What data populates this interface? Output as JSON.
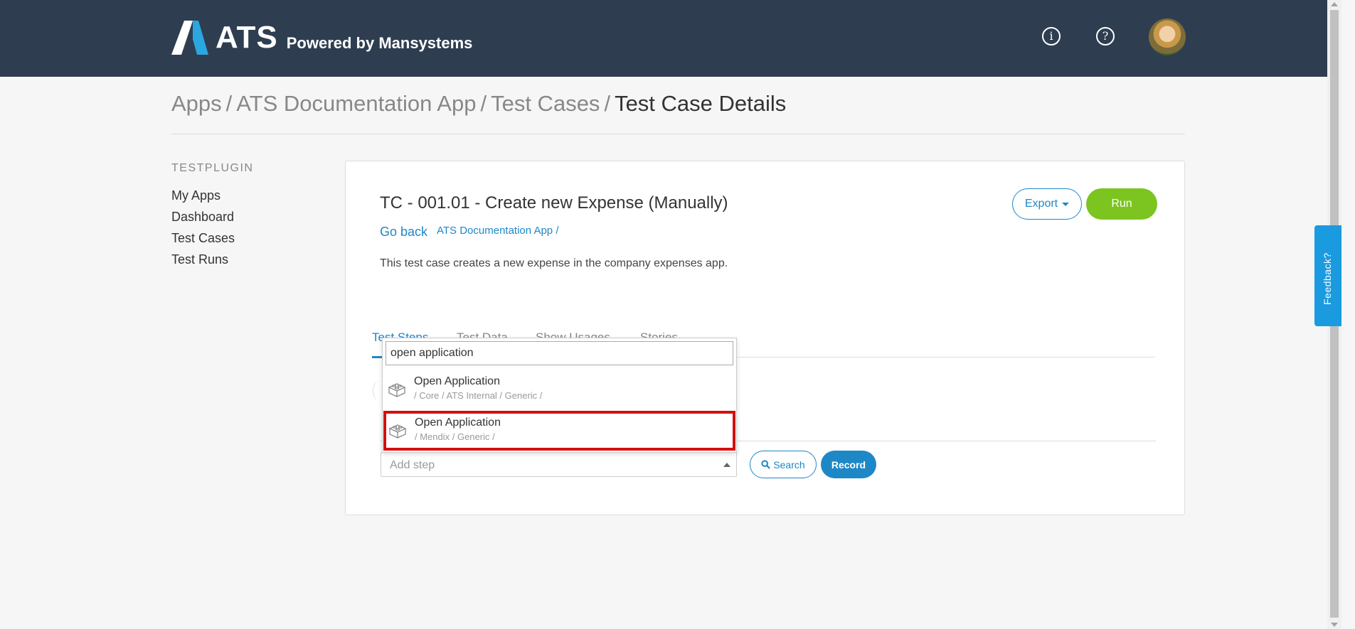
{
  "header": {
    "logo_text": "ATS",
    "logo_sub": "Powered by Mansystems",
    "info_icon": "info-icon",
    "help_icon": "help-icon"
  },
  "breadcrumb": {
    "items": [
      "Apps",
      "ATS Documentation App",
      "Test Cases",
      "Test Case Details"
    ],
    "separator": "/"
  },
  "sidebar": {
    "heading": "TESTPLUGIN",
    "items": [
      {
        "label": "My Apps"
      },
      {
        "label": "Dashboard"
      },
      {
        "label": "Test Cases"
      },
      {
        "label": "Test Runs"
      }
    ]
  },
  "testcase": {
    "title": "TC - 001.01 - Create new Expense (Manually)",
    "go_back": "Go back",
    "app_link": "ATS Documentation App /",
    "description": "This test case creates a new expense in the company expenses app.",
    "export_label": "Export",
    "run_label": "Run"
  },
  "tabs": [
    {
      "label": "Test Steps",
      "active": true
    },
    {
      "label": "Test Data"
    },
    {
      "label": "Show Usages"
    },
    {
      "label": "Stories"
    }
  ],
  "add_step": {
    "placeholder": "Add step",
    "search_label": "Search",
    "record_label": "Record"
  },
  "dropdown": {
    "query": "open application",
    "options": [
      {
        "title": "Open Application",
        "path": "/ Core / ATS Internal / Generic /",
        "highlighted": false
      },
      {
        "title": "Open Application",
        "path": "/ Mendix / Generic /",
        "highlighted": true
      }
    ]
  },
  "feedback_label": "Feedback?",
  "colors": {
    "header_bg": "#2e3e50",
    "accent": "#1e88c7",
    "run": "#7cc520",
    "highlight": "#d40f0f",
    "feedback": "#1a9be0"
  }
}
